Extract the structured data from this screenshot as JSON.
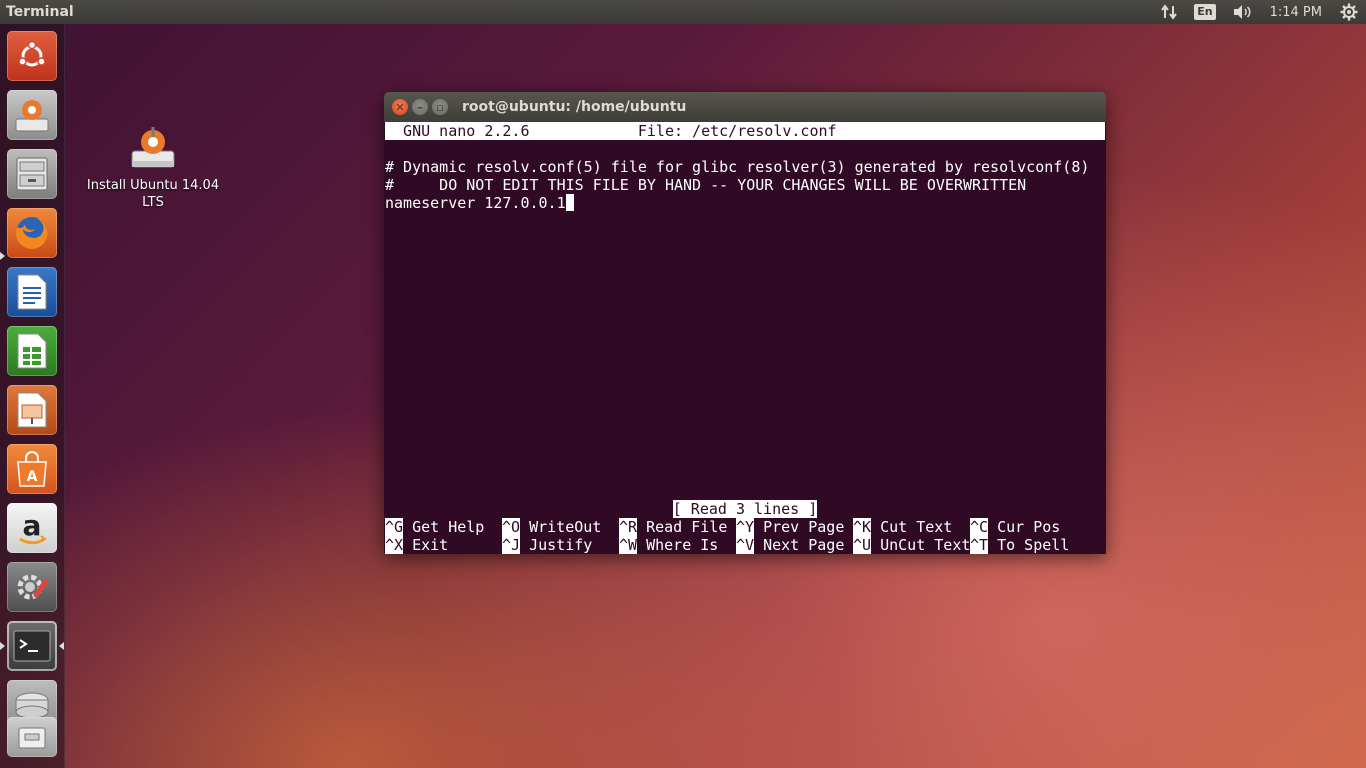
{
  "top_panel": {
    "title": "Terminal",
    "keyboard_layout": "En",
    "clock": "1:14 PM"
  },
  "launcher": {
    "items": [
      {
        "name": "dash-home",
        "icon": "ubuntu-logo-icon"
      },
      {
        "name": "install-ubuntu",
        "icon": "installer-icon"
      },
      {
        "name": "files",
        "icon": "file-cabinet-icon"
      },
      {
        "name": "firefox",
        "icon": "firefox-icon"
      },
      {
        "name": "libreoffice-writer",
        "icon": "writer-icon"
      },
      {
        "name": "libreoffice-calc",
        "icon": "calc-icon"
      },
      {
        "name": "libreoffice-impress",
        "icon": "impress-icon"
      },
      {
        "name": "software-center",
        "icon": "shopping-bag-icon"
      },
      {
        "name": "amazon",
        "icon": "amazon-icon"
      },
      {
        "name": "system-settings",
        "icon": "settings-gear-icon"
      },
      {
        "name": "terminal",
        "icon": "terminal-icon"
      },
      {
        "name": "drive",
        "icon": "hard-drive-icon"
      },
      {
        "name": "trash",
        "icon": "trash-icon"
      }
    ]
  },
  "desktop": {
    "install_icon_label": "Install Ubuntu 14.04 LTS"
  },
  "window": {
    "title": "root@ubuntu: /home/ubuntu",
    "nano_header": "  GNU nano 2.2.6            File: /etc/resolv.conf                              ",
    "lines": [
      "# Dynamic resolv.conf(5) file for glibc resolver(3) generated by resolvconf(8)",
      "#     DO NOT EDIT THIS FILE BY HAND -- YOUR CHANGES WILL BE OVERWRITTEN",
      "nameserver 127.0.0.1"
    ],
    "status": "[ Read 3 lines ]",
    "shortcuts_row1": [
      {
        "key": "^G",
        "label": " Get Help"
      },
      {
        "key": "^O",
        "label": " WriteOut"
      },
      {
        "key": "^R",
        "label": " Read File"
      },
      {
        "key": "^Y",
        "label": " Prev Page"
      },
      {
        "key": "^K",
        "label": " Cut Text"
      },
      {
        "key": "^C",
        "label": " Cur Pos"
      }
    ],
    "shortcuts_row2": [
      {
        "key": "^X",
        "label": " Exit"
      },
      {
        "key": "^J",
        "label": " Justify"
      },
      {
        "key": "^W",
        "label": " Where Is"
      },
      {
        "key": "^V",
        "label": " Next Page"
      },
      {
        "key": "^U",
        "label": " UnCut Text"
      },
      {
        "key": "^T",
        "label": " To Spell"
      }
    ]
  }
}
